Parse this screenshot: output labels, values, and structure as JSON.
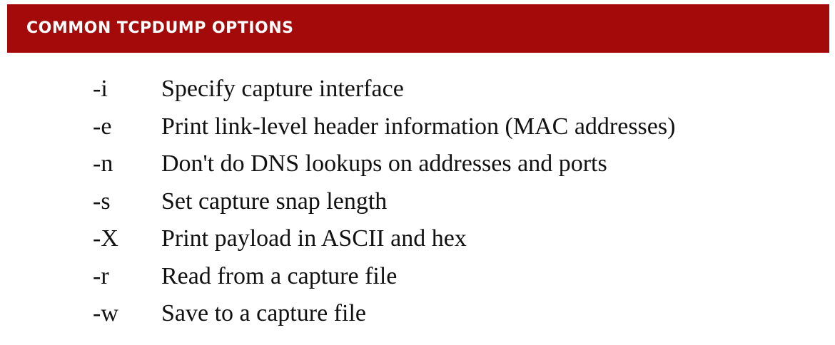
{
  "header": {
    "title": "COMMON TCPDUMP OPTIONS",
    "background_color": "#a50a0a",
    "text_color": "#ffffff"
  },
  "options": [
    {
      "flag": "-i",
      "description": "Specify capture interface"
    },
    {
      "flag": "-e",
      "description": "Print link-level header information (MAC addresses)"
    },
    {
      "flag": "-n",
      "description": "Don't do DNS lookups on addresses and ports"
    },
    {
      "flag": "-s",
      "description": "Set capture snap length"
    },
    {
      "flag": "-X",
      "description": "Print payload in ASCII and hex"
    },
    {
      "flag": "-r",
      "description": "Read from a capture file"
    },
    {
      "flag": "-w",
      "description": "Save to a capture file"
    }
  ]
}
